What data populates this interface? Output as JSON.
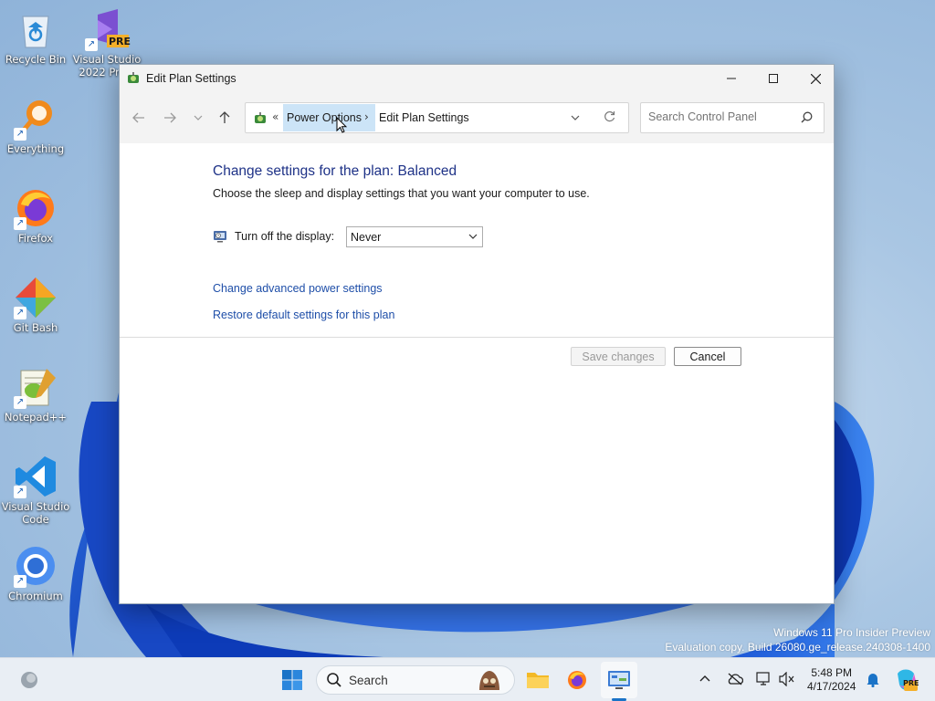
{
  "desktop": {
    "icons": [
      {
        "label": "Recycle Bin",
        "icon": "recycle-bin-icon"
      },
      {
        "label": "Visual Studio 2022 Preview",
        "label_line1": "Visual Studio",
        "label_line2": "2022 Previ",
        "badge": "PRE",
        "icon": "visual-studio-icon"
      },
      {
        "label": "Everything",
        "icon": "everything-icon"
      },
      {
        "label": "Firefox",
        "icon": "firefox-icon"
      },
      {
        "label": "Git Bash",
        "icon": "git-bash-icon"
      },
      {
        "label": "Notepad++",
        "icon": "notepad-plus-plus-icon"
      },
      {
        "label": "Visual Studio Code",
        "label_line1": "Visual Studio",
        "label_line2": "Code",
        "icon": "vscode-icon"
      },
      {
        "label": "Chromium",
        "icon": "chromium-icon"
      }
    ],
    "watermark": {
      "line1": "Windows 11 Pro Insider Preview",
      "line2": "Evaluation copy. Build 26080.ge_release.240308-1400"
    }
  },
  "window": {
    "title": "Edit Plan Settings",
    "controls": {
      "minimize": "minimize-icon",
      "maximize": "maximize-icon",
      "close": "close-icon"
    },
    "nav": {
      "back": "back-arrow-icon",
      "forward": "forward-arrow-icon",
      "recent": "chevron-down-icon",
      "up": "up-arrow-icon"
    },
    "address": {
      "overflow": "«",
      "crumbs": [
        "Power Options",
        "Edit Plan Settings"
      ],
      "separator": "›"
    },
    "search": {
      "placeholder": "Search Control Panel",
      "value": ""
    },
    "content": {
      "heading": "Change settings for the plan: Balanced",
      "description": "Choose the sleep and display settings that you want your computer to use.",
      "display_label": "Turn off the display:",
      "display_value": "Never",
      "link_advanced": "Change advanced power settings",
      "link_restore": "Restore default settings for this plan",
      "save_label": "Save changes",
      "cancel_label": "Cancel"
    }
  },
  "taskbar": {
    "search_label": "Search",
    "clock": {
      "time": "5:48 PM",
      "date": "4/17/2024"
    },
    "badge": "PRE",
    "accent_color": "#1a73c7"
  }
}
